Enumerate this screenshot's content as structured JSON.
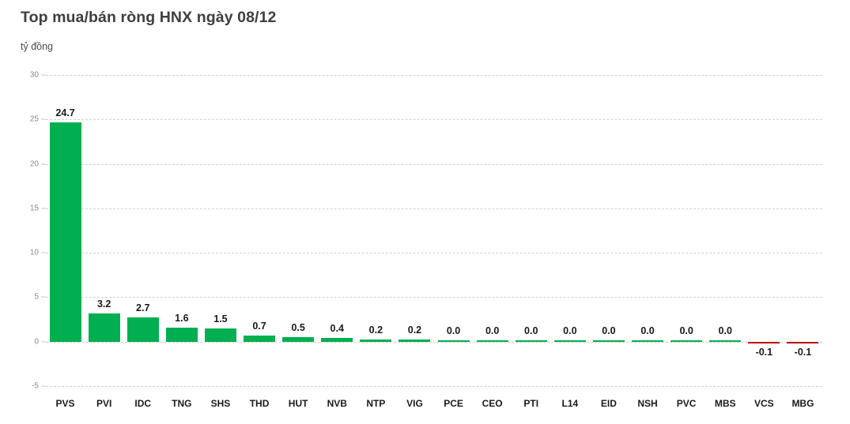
{
  "chart_data": {
    "type": "bar",
    "title": "Top mua/bán ròng HNX ngày 08/12",
    "subtitle": "tỷ đồng",
    "xlabel": "",
    "ylabel": "tỷ đồng",
    "ylim": [
      -5,
      30
    ],
    "yticks": [
      30,
      25,
      20,
      15,
      10,
      5,
      0,
      -5
    ],
    "ytick_labels": [
      "30",
      "25",
      "20",
      "15",
      "10",
      "5",
      "0",
      "-5"
    ],
    "grid": true,
    "legend": "none",
    "categories": [
      "PVS",
      "PVI",
      "IDC",
      "TNG",
      "SHS",
      "THD",
      "HUT",
      "NVB",
      "NTP",
      "VIG",
      "PCE",
      "CEO",
      "PTI",
      "L14",
      "EID",
      "NSH",
      "PVC",
      "MBS",
      "VCS",
      "MBG"
    ],
    "values": [
      24.7,
      3.2,
      2.7,
      1.6,
      1.5,
      0.7,
      0.5,
      0.4,
      0.2,
      0.2,
      0.0,
      0.0,
      0.0,
      0.0,
      0.0,
      0.0,
      0.0,
      0.0,
      -0.1,
      -0.1
    ],
    "data_labels": [
      "24.7",
      "3.2",
      "2.7",
      "1.6",
      "1.5",
      "0.7",
      "0.5",
      "0.4",
      "0.2",
      "0.2",
      "0.0",
      "0.0",
      "0.0",
      "0.0",
      "0.0",
      "0.0",
      "0.0",
      "0.0",
      "-0.1",
      "-0.1"
    ],
    "colors": {
      "positive": "#02af50",
      "negative": "#c00000",
      "grid": "#d3d3d3",
      "title_text": "#3f3f3f",
      "tick_text": "#8a8a8a",
      "label_text": "#1a1a1a",
      "background": "#ffffff"
    }
  }
}
